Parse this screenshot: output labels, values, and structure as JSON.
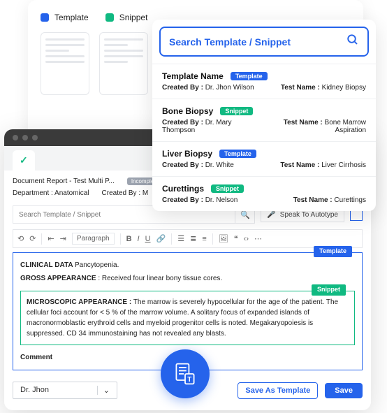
{
  "legend": {
    "template": "Template",
    "snippet": "Snippet"
  },
  "search": {
    "placeholder": "Search Template / Snippet"
  },
  "labels": {
    "createdBy": "Created By :",
    "testName": "Test Name :"
  },
  "results": [
    {
      "title": "Template Name",
      "type": "Template",
      "createdBy": "Dr. Jhon Wilson",
      "testName": "Kidney Biopsy"
    },
    {
      "title": "Bone Biopsy",
      "type": "Snippet",
      "createdBy": "Dr. Mary Thompson",
      "testName": "Bone Marrow Aspiration"
    },
    {
      "title": "Liver Biopsy",
      "type": "Template",
      "createdBy": "Dr. White",
      "testName": "Liver Cirrhosis"
    },
    {
      "title": "Curettings",
      "type": "Snippet",
      "createdBy": "Dr. Nelson",
      "testName": "Curettings"
    }
  ],
  "doc": {
    "title": "Document Report - Test Multi P...",
    "status": "Incompleted",
    "deptLabel": "Department :",
    "dept": "Anatomical",
    "createdByLabel": "Created By :",
    "createdBy": "M",
    "searchPlaceholder": "Search Template / Snippet",
    "speak": "Speak To Autotype",
    "paragraph": "Paragraph"
  },
  "editor": {
    "templateBadge": "Template",
    "snippetBadge": "Snippet",
    "clinicalLabel": "CLINICAL DATA",
    "clinicalText": "Pancytopenia.",
    "grossLabel": "GROSS APPEARANCE",
    "grossText": ": Received four linear bony tissue cores.",
    "microLabel": "MICROSCOPIC APPEARANCE :",
    "microText": "The marrow is severely hypocellular for the age of the patient. The cellular foci account for < 5 % of the marrow volume. A solitary focus of expanded islands of macronormoblastic erythroid cells and myeloid progenitor cells is noted. Megakaryopoiesis is suppressed. CD 34 immunostaining has not revealed any blasts.",
    "comment": "Comment"
  },
  "footer": {
    "user": "Dr. Jhon",
    "saveAs": "Save As Template",
    "save": "Save"
  }
}
